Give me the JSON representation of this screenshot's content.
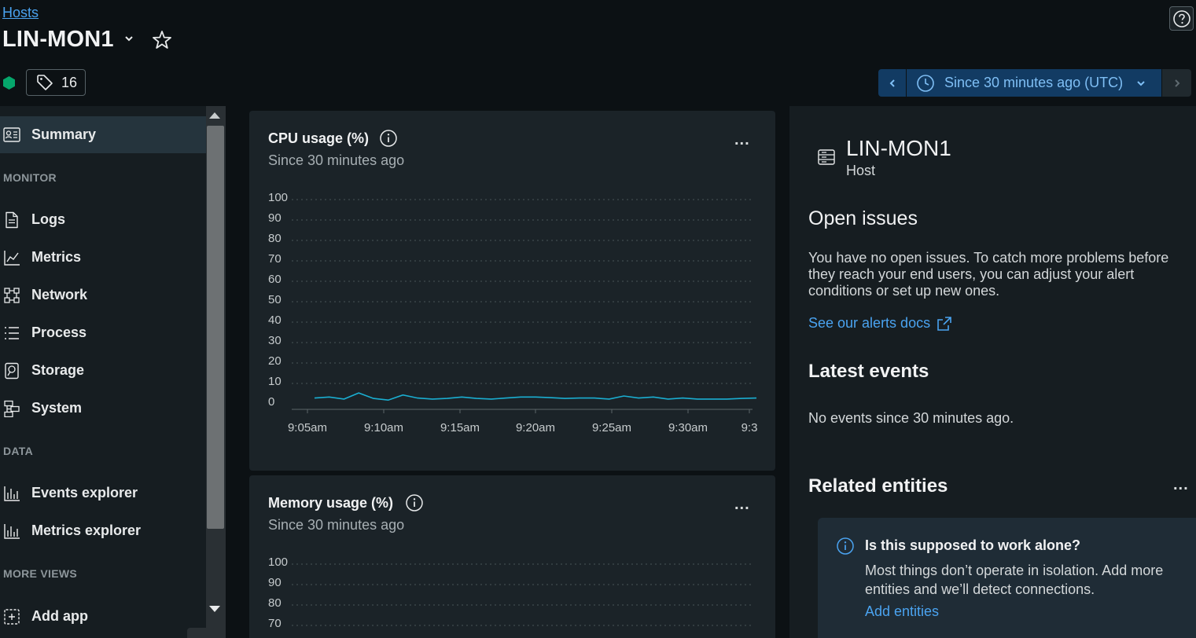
{
  "header": {
    "breadcrumb": "Hosts",
    "title": "LIN-MON1",
    "tag_count": "16",
    "health_color": "#05a66b"
  },
  "time_picker": {
    "label": "Since 30 minutes ago (UTC)"
  },
  "sidebar": {
    "summary": "Summary",
    "sections": {
      "monitor": "MONITOR",
      "data": "DATA",
      "more_views": "MORE VIEWS"
    },
    "monitor_items": [
      {
        "label": "Logs",
        "icon": "document-icon"
      },
      {
        "label": "Metrics",
        "icon": "line-chart-icon"
      },
      {
        "label": "Network",
        "icon": "network-icon"
      },
      {
        "label": "Process",
        "icon": "list-icon"
      },
      {
        "label": "Storage",
        "icon": "storage-icon"
      },
      {
        "label": "System",
        "icon": "system-icon"
      }
    ],
    "data_items": [
      {
        "label": "Events explorer",
        "icon": "bar-chart-icon"
      },
      {
        "label": "Metrics explorer",
        "icon": "bar-chart-icon"
      }
    ],
    "more_items": [
      {
        "label": "Add app",
        "icon": "add-app-icon"
      }
    ]
  },
  "charts": [
    {
      "title": "CPU usage (%)",
      "subtitle": "Since 30 minutes ago",
      "more": "..."
    },
    {
      "title": "Memory usage (%)",
      "subtitle": "Since 30 minutes ago",
      "more": "..."
    }
  ],
  "chart_data": [
    {
      "type": "line",
      "title": "CPU usage (%)",
      "subtitle": "Since 30 minutes ago",
      "yticks": [
        "100",
        "90",
        "80",
        "70",
        "60",
        "50",
        "40",
        "30",
        "20",
        "10",
        "0"
      ],
      "ylim": [
        0,
        100
      ],
      "xticks": [
        "9:05am",
        "9:10am",
        "9:15am",
        "9:20am",
        "9:25am",
        "9:30am",
        "9:3"
      ],
      "series": [
        {
          "color": "#1aaed1",
          "x": [
            "9:05am",
            "9:06am",
            "9:07am",
            "9:08am",
            "9:09am",
            "9:10am",
            "9:11am",
            "9:12am",
            "9:13am",
            "9:14am",
            "9:15am",
            "9:16am",
            "9:17am",
            "9:18am",
            "9:19am",
            "9:20am",
            "9:21am",
            "9:22am",
            "9:23am",
            "9:24am",
            "9:25am",
            "9:26am",
            "9:27am",
            "9:28am",
            "9:29am",
            "9:30am",
            "9:31am",
            "9:32am",
            "9:33am",
            "9:34am",
            "9:35am"
          ],
          "values": [
            4,
            4.5,
            3.5,
            6.5,
            3.8,
            3,
            5.5,
            4,
            3.5,
            3.8,
            4.5,
            3.8,
            3.5,
            4,
            4.5,
            4.5,
            4.2,
            3.8,
            4,
            4,
            3.5,
            5,
            4,
            4.5,
            3.5,
            4,
            3.5,
            3.5,
            3.5,
            3.8,
            4
          ]
        }
      ],
      "grid": true
    },
    {
      "type": "line",
      "title": "Memory usage (%)",
      "subtitle": "Since 30 minutes ago",
      "yticks": [
        "100",
        "90",
        "80",
        "70"
      ],
      "ylim": [
        0,
        100
      ],
      "grid": true
    }
  ],
  "entity": {
    "name": "LIN-MON1",
    "type": "Host",
    "open_issues_title": "Open issues",
    "open_issues_text": "You have no open issues. To catch more problems before they reach your end users, you can adjust your alert conditions or set up new ones.",
    "alerts_link": "See our alerts docs",
    "events_title": "Latest events",
    "events_text": "No events since 30 minutes ago.",
    "related_title": "Related entities",
    "related_more": "...",
    "info_title": "Is this supposed to work alone?",
    "info_text": "Most things don’t operate in isolation. Add more entities and we’ll detect connections.",
    "info_link": "Add entities"
  }
}
